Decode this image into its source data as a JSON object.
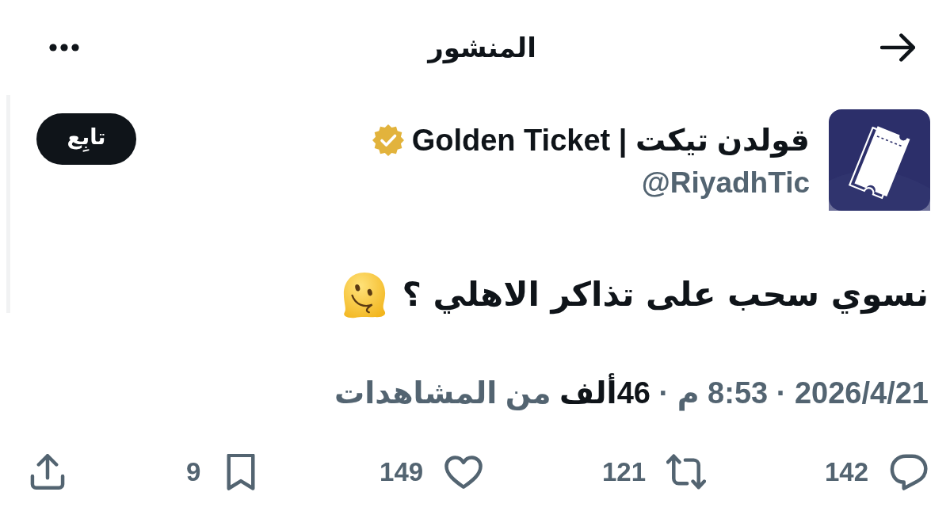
{
  "header": {
    "title": "المنشور"
  },
  "post": {
    "author": {
      "name": "قولدن تيكت | Golden Ticket",
      "verified": true,
      "handle": "@RiyadhTic"
    },
    "follow_button": "تابِع",
    "text": "نسوي سحب على تذاكر الاهلي ؟",
    "meta": "2026/4/21 · 8:53 م · **46ألف** من المشاهدات"
  },
  "actions": [
    {
      "kind": "reply",
      "count": "142"
    },
    {
      "kind": "repost",
      "count": "121"
    },
    {
      "kind": "like",
      "count": "149"
    },
    {
      "kind": "bookmark",
      "count": "9"
    },
    {
      "kind": "share"
    }
  ]
}
